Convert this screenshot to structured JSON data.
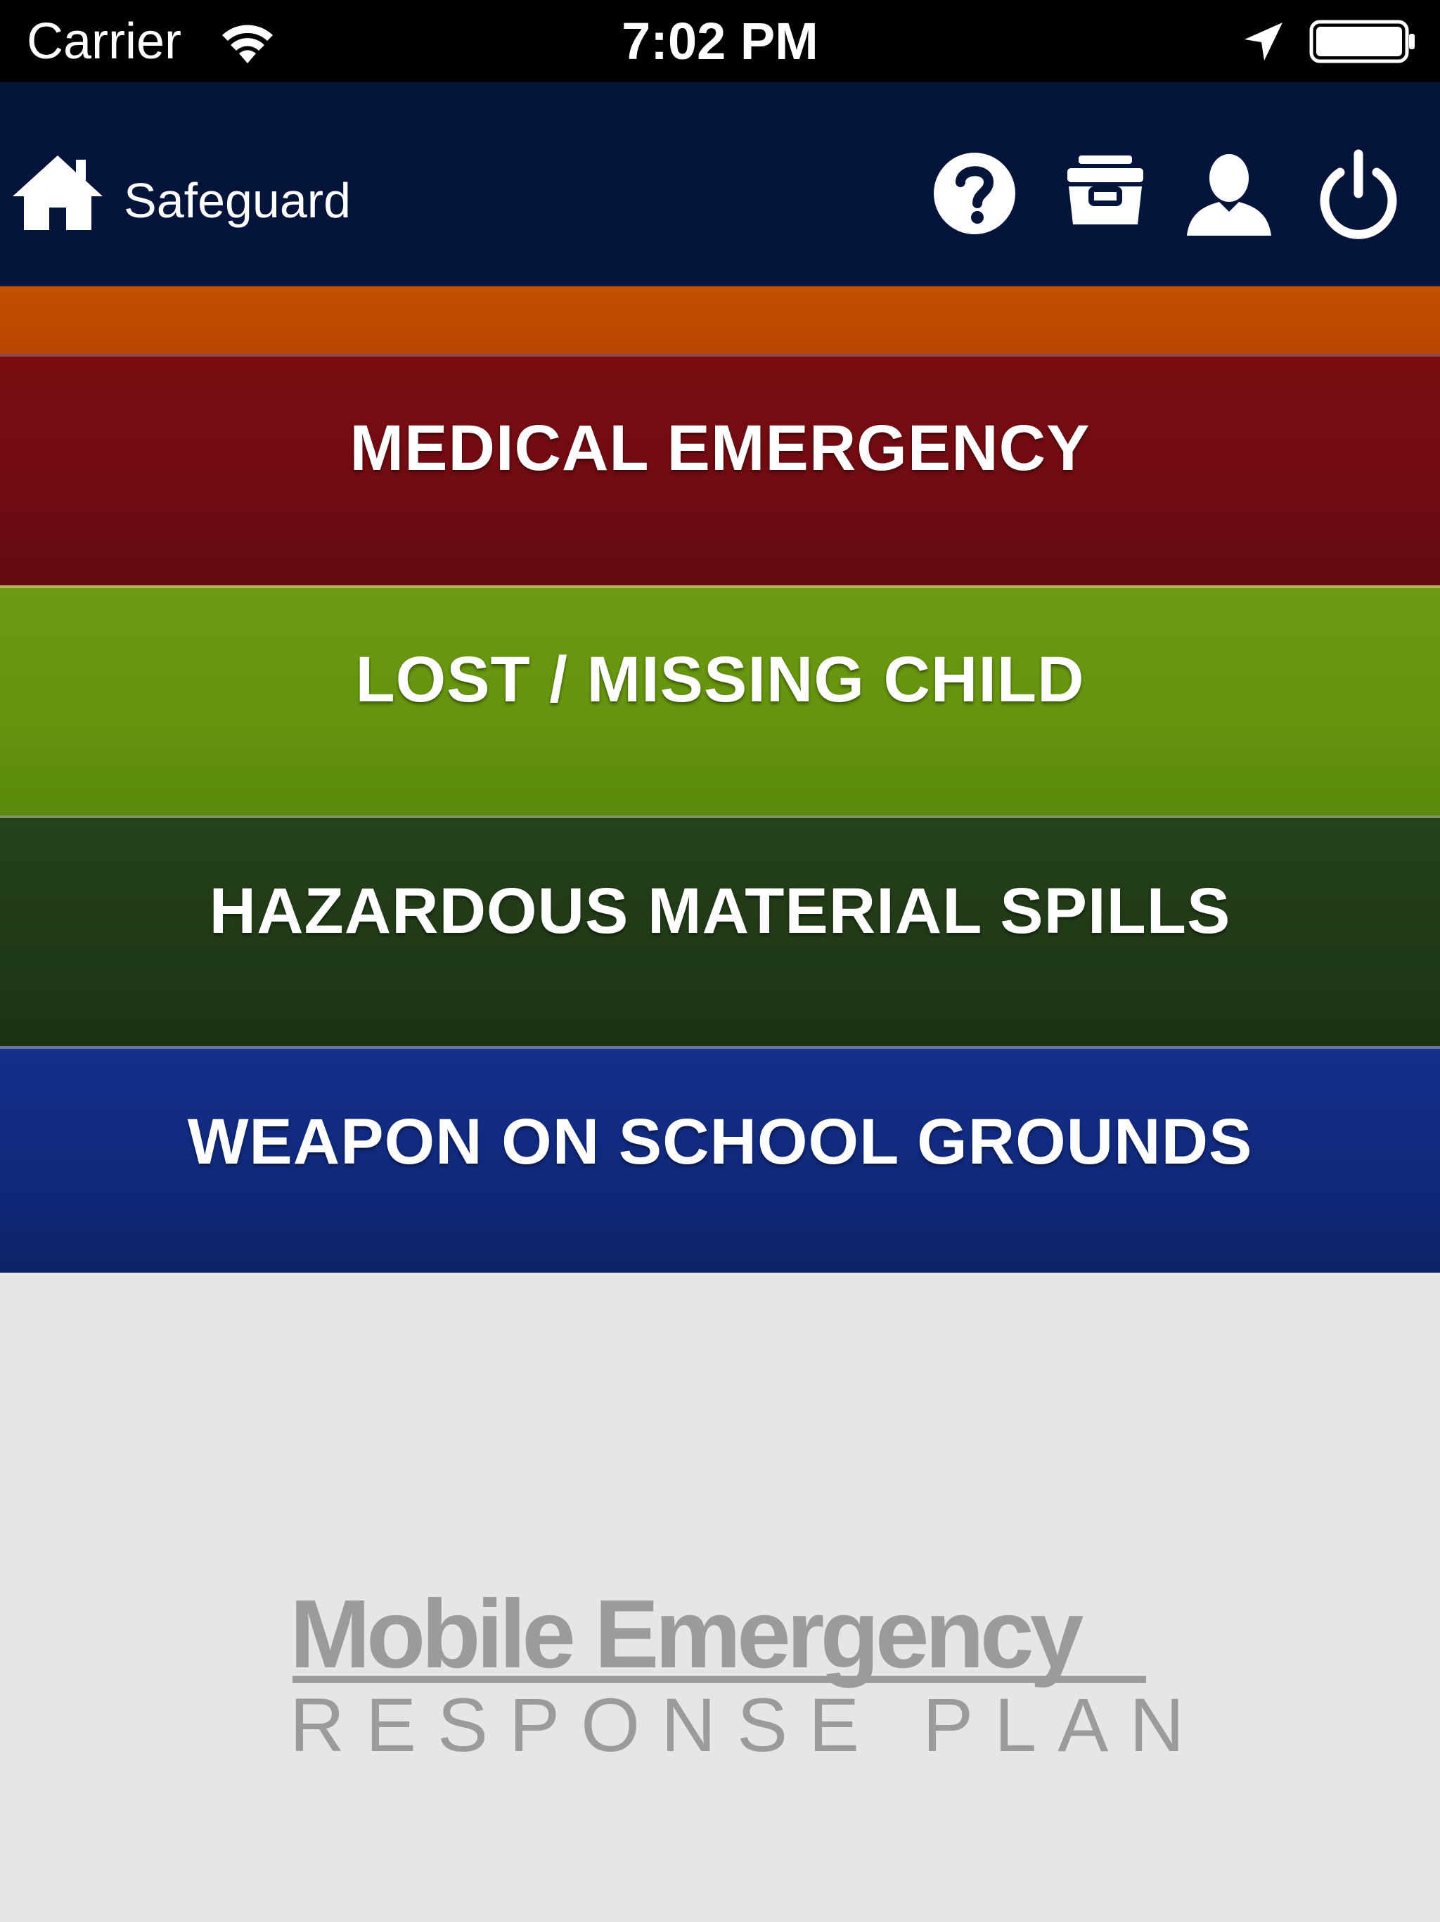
{
  "status_bar": {
    "carrier": "Carrier",
    "time": "7:02 PM",
    "icons": [
      "wifi-icon",
      "location-arrow-icon",
      "battery-icon"
    ]
  },
  "nav": {
    "title": "Safeguard",
    "icons": [
      "home-icon",
      "help-icon",
      "box-icon",
      "user-icon",
      "power-icon"
    ]
  },
  "emergencies": [
    {
      "label": "MEDICAL EMERGENCY",
      "color": "#6f0c12"
    },
    {
      "label": "LOST / MISSING CHILD",
      "color": "#64930e"
    },
    {
      "label": "HAZARDOUS MATERIAL SPILLS",
      "color": "#1f3a16"
    },
    {
      "label": "WEAPON ON SCHOOL GROUNDS",
      "color": "#10287b"
    }
  ],
  "colors": {
    "nav_bg": "#04143a",
    "orange_strip": "#c25000",
    "background": "#e6e6e6",
    "logo_gray": "#9b9b9b"
  },
  "logo": {
    "main": "Mobile Emergency",
    "sub": "RESPONSE PLAN"
  }
}
